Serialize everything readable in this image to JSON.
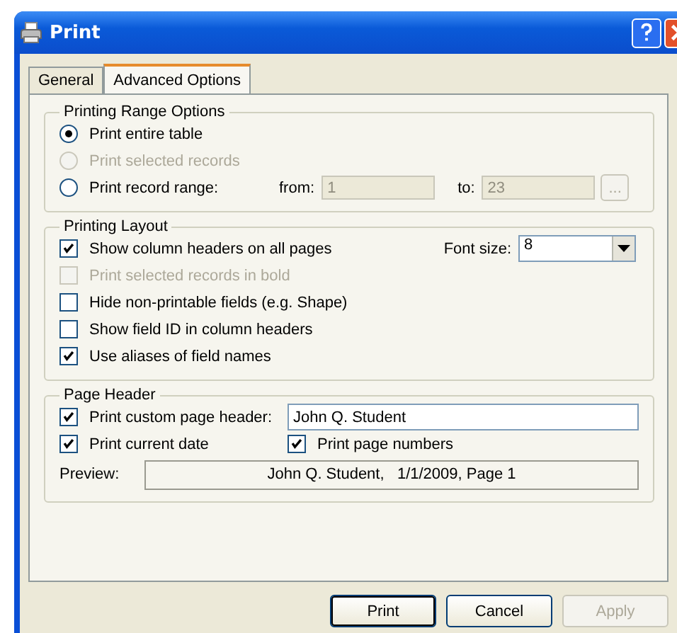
{
  "window": {
    "title": "Print"
  },
  "tabs": [
    {
      "label": "General",
      "selected": false
    },
    {
      "label": "Advanced Options",
      "selected": true
    }
  ],
  "range_group": {
    "title": "Printing Range Options",
    "options": [
      {
        "label": "Print entire table",
        "selected": true,
        "disabled": false
      },
      {
        "label": "Print selected records",
        "selected": false,
        "disabled": true
      },
      {
        "label": "Print record range:",
        "selected": false,
        "disabled": false
      }
    ],
    "from": {
      "label": "from:",
      "value": "1",
      "disabled": true
    },
    "to": {
      "label": "to:",
      "value": "23",
      "disabled": true
    },
    "browse_button": {
      "label": "...",
      "disabled": true
    }
  },
  "layout_group": {
    "title": "Printing Layout",
    "checkboxes": [
      {
        "label": "Show column headers on all pages",
        "checked": true,
        "disabled": false
      },
      {
        "label": "Print selected records in bold",
        "checked": false,
        "disabled": true
      },
      {
        "label": "Hide non-printable fields (e.g. Shape)",
        "checked": false,
        "disabled": false
      },
      {
        "label": "Show field ID in column headers",
        "checked": false,
        "disabled": false
      },
      {
        "label": "Use aliases of field names",
        "checked": true,
        "disabled": false
      }
    ],
    "font_size": {
      "label": "Font size:",
      "value": "8"
    }
  },
  "header_group": {
    "title": "Page Header",
    "custom_header": {
      "label": "Print custom page header:",
      "checked": true,
      "value": "John Q. Student"
    },
    "date": {
      "label": "Print current date",
      "checked": true
    },
    "page_numbers": {
      "label": "Print page numbers",
      "checked": true
    },
    "preview": {
      "label": "Preview:",
      "value": "John Q. Student,   1/1/2009, Page 1"
    }
  },
  "buttons": [
    {
      "label": "Print",
      "kind": "default",
      "disabled": false
    },
    {
      "label": "Cancel",
      "kind": "normal",
      "disabled": false
    },
    {
      "label": "Apply",
      "kind": "normal",
      "disabled": true
    }
  ]
}
